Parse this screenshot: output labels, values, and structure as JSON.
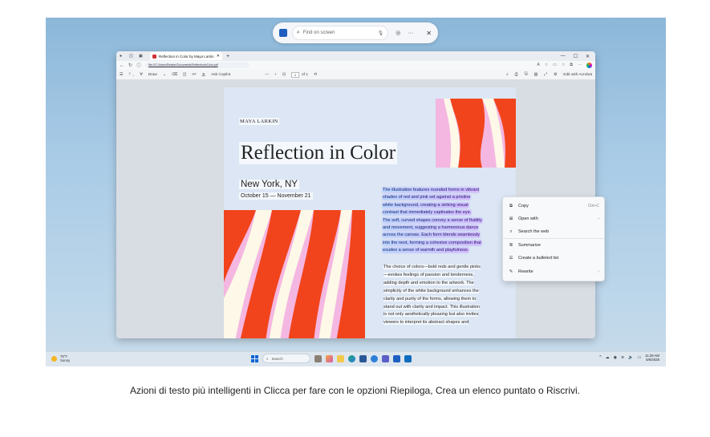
{
  "click_to_do": {
    "search_placeholder": "Find on screen"
  },
  "browser": {
    "tab_title": "Reflection in Color by Maya Larkin",
    "address": "file:///C:/Users/Reader/Documents/ReflectionInColor.pdf",
    "toolbar": {
      "draw_label": "Draw",
      "ask_copilot_label": "Ask Copilot",
      "page_current": "1",
      "page_total": "of 1",
      "edit_acrobat_label": "Edit with Acrobat"
    }
  },
  "document": {
    "author": "MAYA LARKIN",
    "title": "Reflection in Color",
    "city": "New York, NY",
    "dates": "October 15 — November 21",
    "selected_lines": [
      "The illustration features rounded forms in vibrant",
      "shades of red and pink set against a pristine",
      "white background, creating a striking visual",
      "contrast that immediately captivates the eye.",
      "The soft, curved shapes convey a sense of fluidity",
      "and movement, suggesting a harmonious dance",
      "across the canvas. Each form blends seamlessly",
      "into the next, forming a cohesive composition that",
      "exudes a sense of warmth and playfulness."
    ],
    "body_lines": [
      "The choice of colors—bold reds and gentle pinks",
      "—evokes feelings of passion and tenderness,",
      "adding depth and emotion to the artwork. The",
      "simplicity of the white background enhances the",
      "clarity and purity of the forms, allowing them to",
      "stand out with clarity and impact. This illustration",
      "is not only aesthetically pleasing but also invites",
      "viewers to interpret its abstract shapes and"
    ],
    "art_colors": {
      "red": "#f1441c",
      "pink": "#f4b7e1",
      "cream": "#fdf8e8"
    }
  },
  "context_menu": {
    "items": [
      {
        "label": "Copy",
        "icon": "copy-icon",
        "shortcut": "Ctrl+C"
      },
      {
        "label": "Open with",
        "icon": "open-with-icon",
        "submenu": true
      },
      {
        "label": "Search the web",
        "icon": "web-search-icon"
      },
      {
        "label": "Summarize",
        "icon": "summarize-icon"
      },
      {
        "label": "Create a bulleted list",
        "icon": "bulleted-list-icon"
      },
      {
        "label": "Rewrite",
        "icon": "rewrite-icon",
        "submenu": true
      }
    ]
  },
  "taskbar": {
    "weather_temp": "78°F",
    "weather_desc": "Sunny",
    "search_label": "Search",
    "time": "11:28 AM",
    "date": "5/6/2025"
  },
  "caption": "Azioni di testo più intelligenti in Clicca per fare con le opzioni Riepiloga, Crea un elenco puntato o Riscrivi."
}
